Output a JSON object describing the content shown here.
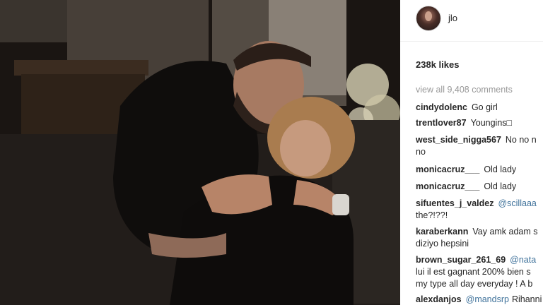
{
  "post": {
    "username": "jlo",
    "likes": "238k likes",
    "view_all": "view all 9,408 comments"
  },
  "comments": [
    {
      "user": "cindydolenc",
      "lines": [
        "Go girl"
      ]
    },
    {
      "user": "trentlover87",
      "lines": [
        "Youngins□"
      ]
    },
    {
      "user": "west_side_nigga567",
      "lines": [
        "No no n",
        "no"
      ]
    },
    {
      "user": "monicacruz___",
      "lines": [
        "Old lady"
      ]
    },
    {
      "user": "monicacruz___",
      "lines": [
        "Old lady"
      ]
    },
    {
      "user": "sifuentes_j_valdez",
      "mention": "@scillaaa",
      "lines": [
        "the?!??!"
      ]
    },
    {
      "user": "karaberkann",
      "lines": [
        "Vay amk adam s",
        "diziyo hepsini"
      ]
    },
    {
      "user": "brown_sugar_261_69",
      "mention": "@nata",
      "lines": [
        "lui il est gagnant 200% bien s",
        "my type all day everyday ! A b"
      ]
    },
    {
      "user": "alexdanjos",
      "mention": "@mandsrp",
      "lines": [
        "Rihanni"
      ]
    }
  ],
  "colors": {
    "text": "#262626",
    "muted": "#999999",
    "mention": "#3f729b",
    "divider": "#efefef"
  },
  "icons": {
    "avatar": "profile-avatar"
  }
}
